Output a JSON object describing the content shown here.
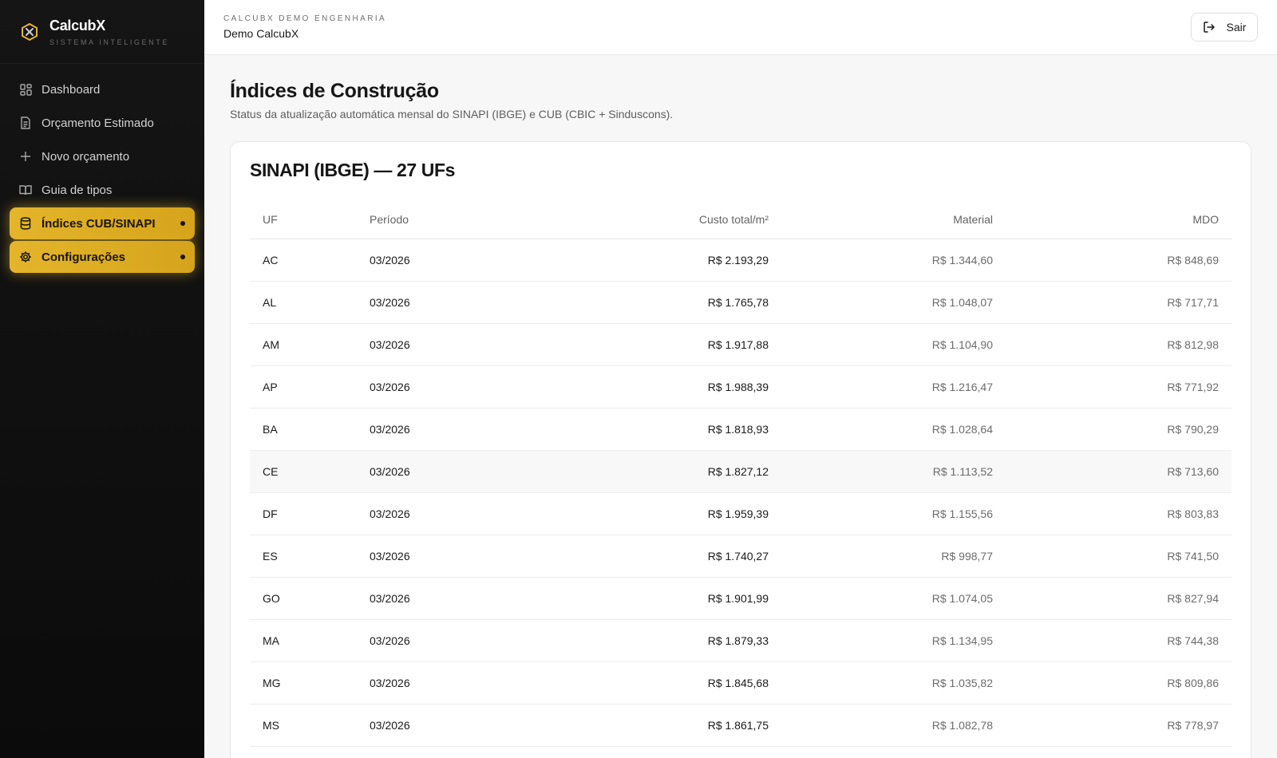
{
  "brand": {
    "name": "CalcubX",
    "subtitle": "SISTEMA INTELIGENTE"
  },
  "sidebar": {
    "items": [
      {
        "label": "Dashboard",
        "icon": "grid-icon",
        "active": false
      },
      {
        "label": "Orçamento Estimado",
        "icon": "document-icon",
        "active": false
      },
      {
        "label": "Novo orçamento",
        "icon": "plus-icon",
        "active": false
      },
      {
        "label": "Guia de tipos",
        "icon": "book-icon",
        "active": false
      },
      {
        "label": "Índices CUB/SINAPI",
        "icon": "database-icon",
        "active": true
      },
      {
        "label": "Configurações",
        "icon": "gear-icon",
        "active": true
      }
    ]
  },
  "header": {
    "company": "CALCUBX DEMO ENGENHARIA",
    "account": "Demo CalcubX",
    "logout_label": "Sair"
  },
  "page": {
    "title": "Índices de Construção",
    "subtitle": "Status da atualização automática mensal do SINAPI (IBGE) e CUB (CBIC + Sinduscons)."
  },
  "table": {
    "title": "SINAPI (IBGE) — 27 UFs",
    "columns": [
      "UF",
      "Período",
      "Custo total/m²",
      "Material",
      "MDO"
    ],
    "rows": [
      {
        "uf": "AC",
        "periodo": "03/2026",
        "custo": "R$ 2.193,29",
        "material": "R$ 1.344,60",
        "mdo": "R$ 848,69"
      },
      {
        "uf": "AL",
        "periodo": "03/2026",
        "custo": "R$ 1.765,78",
        "material": "R$ 1.048,07",
        "mdo": "R$ 717,71"
      },
      {
        "uf": "AM",
        "periodo": "03/2026",
        "custo": "R$ 1.917,88",
        "material": "R$ 1.104,90",
        "mdo": "R$ 812,98"
      },
      {
        "uf": "AP",
        "periodo": "03/2026",
        "custo": "R$ 1.988,39",
        "material": "R$ 1.216,47",
        "mdo": "R$ 771,92"
      },
      {
        "uf": "BA",
        "periodo": "03/2026",
        "custo": "R$ 1.818,93",
        "material": "R$ 1.028,64",
        "mdo": "R$ 790,29"
      },
      {
        "uf": "CE",
        "periodo": "03/2026",
        "custo": "R$ 1.827,12",
        "material": "R$ 1.113,52",
        "mdo": "R$ 713,60"
      },
      {
        "uf": "DF",
        "periodo": "03/2026",
        "custo": "R$ 1.959,39",
        "material": "R$ 1.155,56",
        "mdo": "R$ 803,83"
      },
      {
        "uf": "ES",
        "periodo": "03/2026",
        "custo": "R$ 1.740,27",
        "material": "R$ 998,77",
        "mdo": "R$ 741,50"
      },
      {
        "uf": "GO",
        "periodo": "03/2026",
        "custo": "R$ 1.901,99",
        "material": "R$ 1.074,05",
        "mdo": "R$ 827,94"
      },
      {
        "uf": "MA",
        "periodo": "03/2026",
        "custo": "R$ 1.879,33",
        "material": "R$ 1.134,95",
        "mdo": "R$ 744,38"
      },
      {
        "uf": "MG",
        "periodo": "03/2026",
        "custo": "R$ 1.845,68",
        "material": "R$ 1.035,82",
        "mdo": "R$ 809,86"
      },
      {
        "uf": "MS",
        "periodo": "03/2026",
        "custo": "R$ 1.861,75",
        "material": "R$ 1.082,78",
        "mdo": "R$ 778,97"
      }
    ]
  },
  "colors": {
    "accent": "#e4b52b",
    "sidebar_bg": "#0f0f0f",
    "page_bg": "#f7f7f8"
  }
}
